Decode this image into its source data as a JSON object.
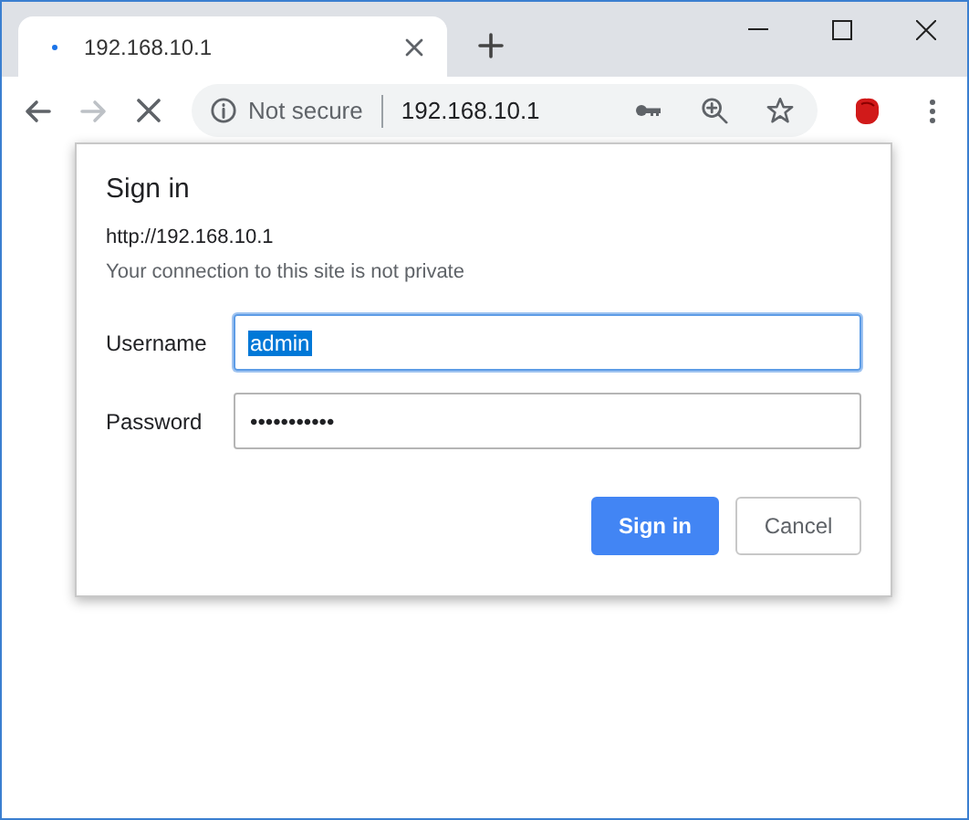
{
  "tab": {
    "title": "192.168.10.1",
    "loading": true
  },
  "address_bar": {
    "security": "Not secure",
    "url": "192.168.10.1"
  },
  "dialog": {
    "title": "Sign in",
    "origin": "http://192.168.10.1",
    "warning": "Your connection to this site is not private",
    "fields": [
      {
        "label": "Username",
        "value": "admin",
        "focused": true,
        "selected": true
      },
      {
        "label": "Password",
        "value": "•••••••••••",
        "focused": false,
        "selected": false
      }
    ],
    "buttons": [
      {
        "label": "Sign in",
        "kind": "primary"
      },
      {
        "label": "Cancel",
        "kind": "secondary"
      }
    ]
  }
}
